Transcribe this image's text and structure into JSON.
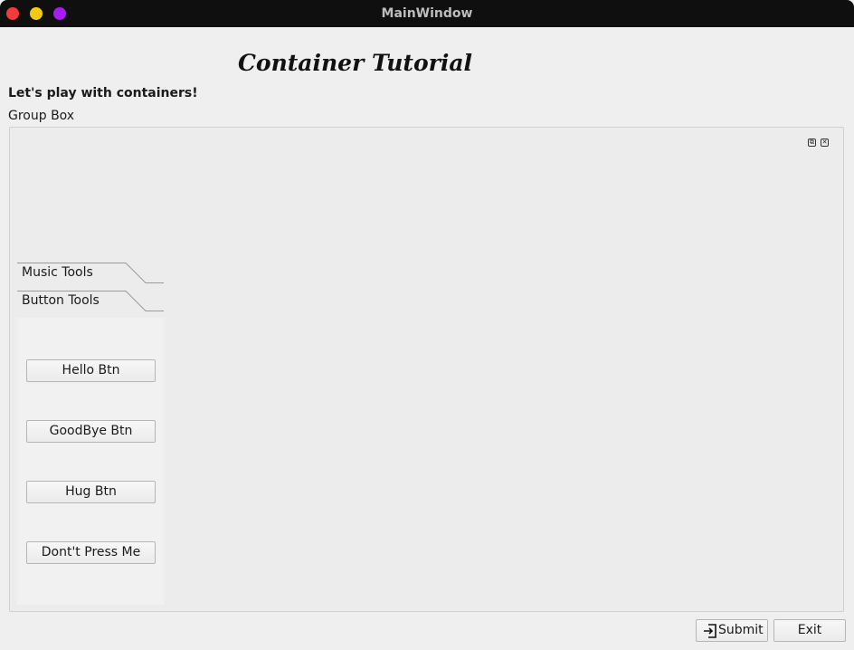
{
  "window": {
    "title": "MainWindow"
  },
  "header": {
    "title": "Container Tutorial",
    "subtitle": "Let's play with containers!"
  },
  "group_box": {
    "title": "Group Box",
    "toolbox": {
      "tabs": [
        {
          "label": "Music Tools"
        },
        {
          "label": "Button Tools"
        }
      ],
      "buttons": [
        {
          "label": "Hello Btn"
        },
        {
          "label": "GoodBye Btn"
        },
        {
          "label": "Hug Btn"
        },
        {
          "label": "Dont't Press Me"
        }
      ]
    }
  },
  "footer": {
    "submit_label": "Submit",
    "exit_label": "Exit",
    "submit_icon": "enter-icon"
  },
  "colors": {
    "titlebar": "#0f0f0f",
    "close": "#f43b3b",
    "minimize": "#f6c90f",
    "maximize": "#a81cf0"
  }
}
